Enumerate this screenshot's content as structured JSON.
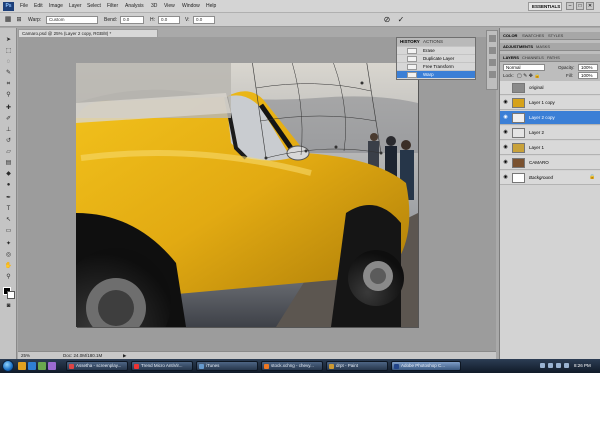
{
  "app": {
    "logo": "Ps",
    "menu": [
      "File",
      "Edit",
      "Image",
      "Layer",
      "Select",
      "Filter",
      "Analysis",
      "3D",
      "View",
      "Window",
      "Help"
    ],
    "workspace": "ESSENTIALS",
    "window_controls": [
      "–",
      "□",
      "✕"
    ]
  },
  "options_bar": {
    "warp_label": "Warp:",
    "warp_value": "Custom",
    "bend_label": "Bend:",
    "bend_value": "0.0",
    "h_label": "H:",
    "h_value": "0.0",
    "v_label": "V:",
    "v_value": "0.0",
    "cancel_icon": "cancel-icon",
    "commit_icon": "commit-icon"
  },
  "document": {
    "tab_title": "Camaro.psd @ 25% (Layer 2 copy, RGB/8) *",
    "zoom": "25%",
    "doc_size": "Doc: 24.0M/180.1M"
  },
  "history_panel": {
    "tabs": [
      "HISTORY",
      "ACTIONS"
    ],
    "items": [
      {
        "label": "Erase",
        "selected": false
      },
      {
        "label": "Duplicate Layer",
        "selected": false
      },
      {
        "label": "Free Transform",
        "selected": false
      },
      {
        "label": "Warp",
        "selected": true
      }
    ]
  },
  "right_panels": {
    "color_tabs": [
      "COLOR",
      "SWATCHES",
      "STYLES"
    ],
    "adjust_tabs": [
      "ADJUSTMENTS",
      "MASKS"
    ],
    "layer_tabs": [
      "LAYERS",
      "CHANNELS",
      "PATHS"
    ],
    "blend_mode": "Normal",
    "opacity_label": "Opacity:",
    "opacity_value": "100%",
    "lock_label": "Lock:",
    "fill_label": "Fill:",
    "fill_value": "100%"
  },
  "layers": [
    {
      "name": "original",
      "visible": false,
      "selected": false,
      "thumb": "#8a8a8a",
      "italic": false,
      "locked": false
    },
    {
      "name": "Layer 1 copy",
      "visible": true,
      "selected": false,
      "thumb": "#d6a21a",
      "italic": false,
      "locked": false
    },
    {
      "name": "Layer 2 copy",
      "visible": true,
      "selected": true,
      "thumb": "#efefef",
      "italic": false,
      "locked": false
    },
    {
      "name": "Layer 2",
      "visible": true,
      "selected": false,
      "thumb": "#e4e4e4",
      "italic": false,
      "locked": false
    },
    {
      "name": "Layer 1",
      "visible": true,
      "selected": false,
      "thumb": "#c9a23a",
      "italic": false,
      "locked": false
    },
    {
      "name": "CAMARO",
      "visible": true,
      "selected": false,
      "thumb": "#7a5230",
      "italic": false,
      "locked": false
    },
    {
      "name": "Background",
      "visible": true,
      "selected": false,
      "thumb": "#ffffff",
      "italic": true,
      "locked": true
    }
  ],
  "taskbar": {
    "tasks": [
      {
        "label": "Assetha - screenplay...",
        "color": "#d44",
        "active": false
      },
      {
        "label": "Trend Micro AntiVir...",
        "color": "#e33",
        "active": false
      },
      {
        "label": "iTunes",
        "color": "#69c",
        "active": false
      },
      {
        "label": "stock.xchng - chevy...",
        "color": "#e72",
        "active": false
      },
      {
        "label": "drpt - Paint",
        "color": "#c93",
        "active": false
      },
      {
        "label": "Adobe Photoshop C...",
        "color": "#248",
        "active": true
      }
    ],
    "clock": "8:26 PM"
  }
}
